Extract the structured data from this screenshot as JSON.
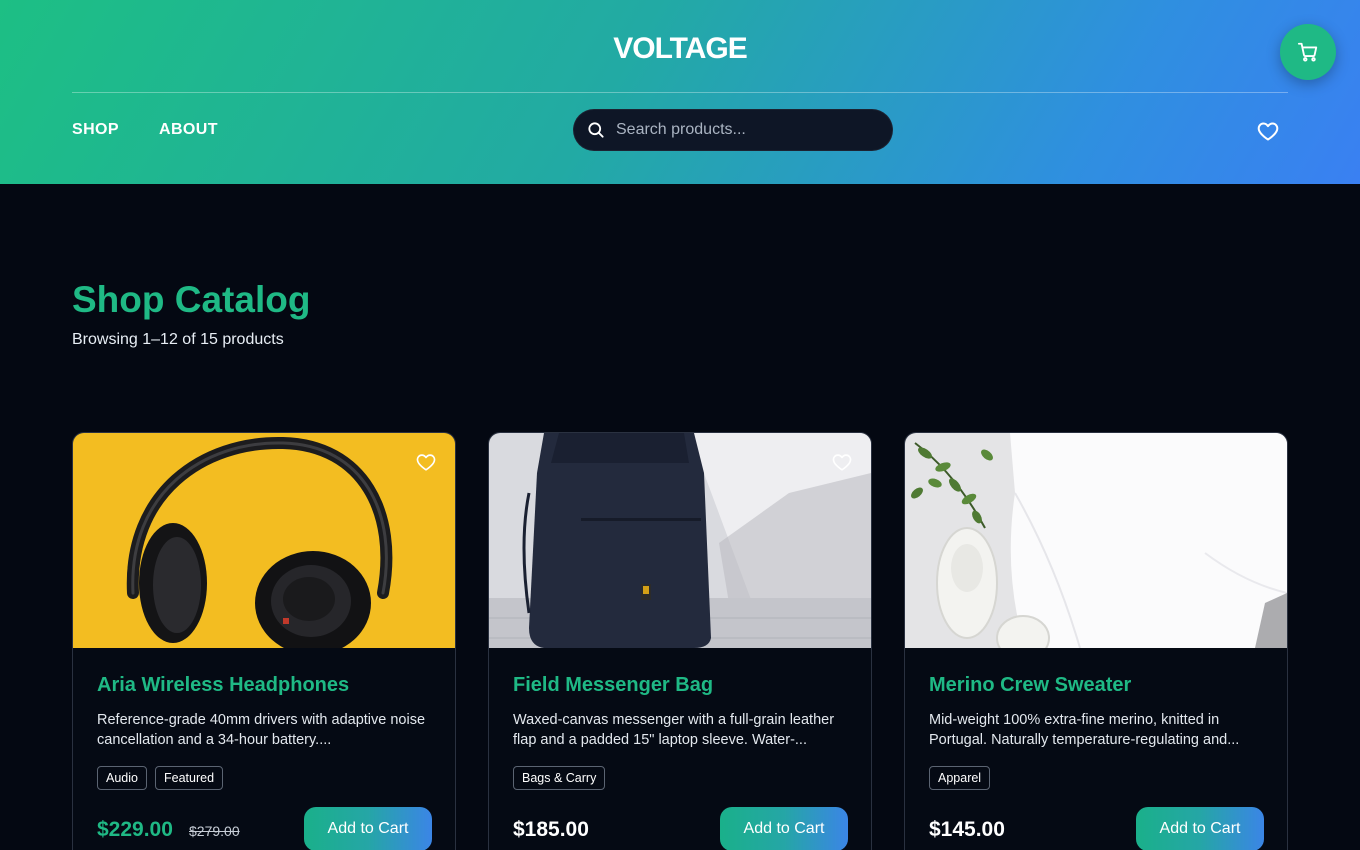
{
  "brand": {
    "name": "VOLTAGE"
  },
  "header": {
    "nav": [
      {
        "label": "SHOP"
      },
      {
        "label": "ABOUT"
      }
    ],
    "search": {
      "placeholder": "Search products...",
      "value": ""
    },
    "icons": [
      "cart-icon",
      "search-icon",
      "heart-icon"
    ]
  },
  "catalog": {
    "title": "Shop Catalog",
    "subtitle": "Browsing 1–12 of 15 products",
    "products": [
      {
        "name": "Aria Wireless Headphones",
        "description": "Reference-grade 40mm drivers with adaptive noise cancellation and a 34-hour battery....",
        "tags": [
          "Audio",
          "Featured"
        ],
        "price": "$229.00",
        "old_price": "$279.00",
        "button": "Add to Cart"
      },
      {
        "name": "Field Messenger Bag",
        "description": "Waxed-canvas messenger with a full-grain leather flap and a padded 15\" laptop sleeve. Water-...",
        "tags": [
          "Bags & Carry"
        ],
        "price": "$185.00",
        "button": "Add to Cart"
      },
      {
        "name": "Merino Crew Sweater",
        "description": "Mid-weight 100% extra-fine merino, knitted in Portugal. Naturally temperature-regulating and...",
        "tags": [
          "Apparel"
        ],
        "price": "$145.00",
        "button": "Add to Cart"
      }
    ]
  },
  "colors": {
    "accent": "#1fb985",
    "background": "#040812",
    "header_start": "#1dbf84",
    "header_end": "#3a80f2"
  }
}
